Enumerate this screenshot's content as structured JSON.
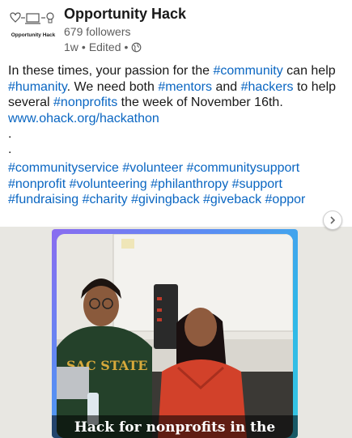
{
  "header": {
    "org_name": "Opportunity Hack",
    "logo_text": "Opportunity Hack",
    "followers": "679 followers",
    "age": "1w",
    "separator": "•",
    "edited": "Edited",
    "visibility_icon": "globe-icon"
  },
  "post": {
    "p1": [
      {
        "t": "In these times, your passion for the ",
        "tag": false
      },
      {
        "t": "#community",
        "tag": true
      },
      {
        "t": " can help ",
        "tag": false
      },
      {
        "t": "#humanity",
        "tag": true
      },
      {
        "t": ". We need both ",
        "tag": false
      },
      {
        "t": "#mentors",
        "tag": true
      },
      {
        "t": " and ",
        "tag": false
      },
      {
        "t": "#hackers",
        "tag": true
      },
      {
        "t": " to help several ",
        "tag": false
      },
      {
        "t": "#nonprofits",
        "tag": true
      },
      {
        "t": " the week of November 16th.",
        "tag": false
      }
    ],
    "link": "www.ohack.org/hackathon",
    "dot1": ".",
    "dot2": ".",
    "hashtags_line1": "#communityservice #volunteer #communitysupport",
    "hashtags_line2": "#nonprofit #volunteering #philanthropy #support",
    "hashtags_line3": "#fundraising #charity #givingback #giveback #oppor"
  },
  "carousel": {
    "caption": "Hack for nonprofits in the",
    "next_icon": "chevron-right-icon",
    "sweatshirt_text": "SAC STATE"
  },
  "colors": {
    "link": "#0a66c2",
    "text": "#191919",
    "muted": "#5e5e5e",
    "carousel_bg": "#e8e7e2"
  }
}
